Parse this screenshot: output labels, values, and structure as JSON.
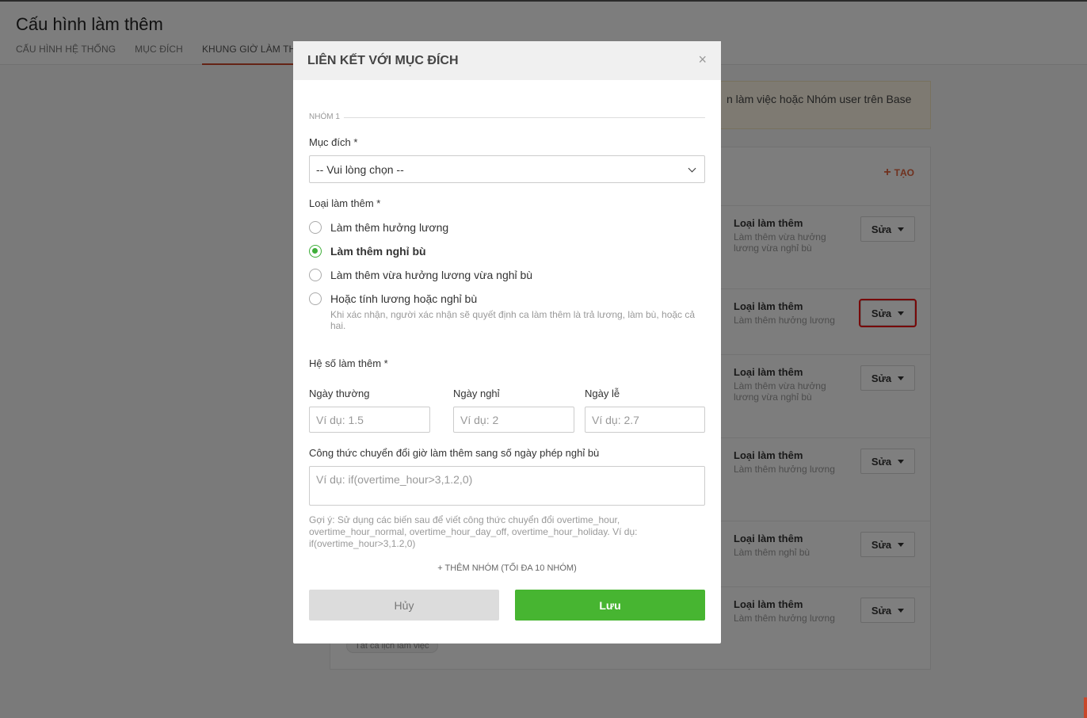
{
  "page": {
    "title": "Cấu hình làm thêm",
    "tabs": [
      "CẤU HÌNH HỆ THỐNG",
      "MỤC ĐÍCH",
      "KHUNG GIỜ LÀM THÊM"
    ],
    "notice": "n làm việc hoặc Nhóm user trên Base",
    "create_label": "TẠO",
    "chip": "Tất cả lịch làm việc",
    "rows": [
      {
        "title": "Loại làm thêm",
        "desc": "Làm thêm vừa hưởng lương vừa nghỉ bù",
        "edit": "Sửa"
      },
      {
        "title": "Loại làm thêm",
        "desc": "Làm thêm hưởng lương",
        "edit": "Sửa"
      },
      {
        "title": "Loại làm thêm",
        "desc": "Làm thêm vừa hưởng lương vừa nghỉ bù",
        "edit": "Sửa"
      },
      {
        "title": "Loại làm thêm",
        "desc": "Làm thêm hưởng lương",
        "edit": "Sửa"
      },
      {
        "title": "Loại làm thêm",
        "desc": "Làm thêm nghỉ bù",
        "edit": "Sửa"
      },
      {
        "title": "Loại làm thêm",
        "desc": "Làm thêm hưởng lương",
        "edit": "Sửa"
      }
    ]
  },
  "modal": {
    "title": "LIÊN KẾT VỚI MỤC ĐÍCH",
    "close": "×",
    "group_label": "NHÓM 1",
    "purpose_label": "Mục đích *",
    "purpose_value": "-- Vui lòng chọn --",
    "type_label": "Loại làm thêm *",
    "options": [
      {
        "label": "Làm thêm hưởng lương",
        "checked": false
      },
      {
        "label": "Làm thêm nghỉ bù",
        "checked": true
      },
      {
        "label": "Làm thêm vừa hưởng lương vừa nghỉ bù",
        "checked": false
      },
      {
        "label": "Hoặc tính lương hoặc nghỉ bù",
        "checked": false
      }
    ],
    "option_hint": "Khi xác nhận, người xác nhận sẽ quyết định ca làm thêm là trả lương, làm bù, hoặc cả hai.",
    "coef_label": "Hệ số làm thêm *",
    "coef_fields": [
      {
        "label": "Ngày thường",
        "placeholder": "Ví dụ: 1.5"
      },
      {
        "label": "Ngày nghỉ",
        "placeholder": "Ví dụ: 2"
      },
      {
        "label": "Ngày lễ",
        "placeholder": "Ví dụ: 2.7"
      }
    ],
    "formula_label": "Công thức chuyển đổi giờ làm thêm sang số ngày phép nghỉ bù",
    "formula_placeholder": "Ví dụ: if(overtime_hour>3,1.2,0)",
    "formula_hint": "Gợi ý: Sử dụng các biến sau để viết công thức chuyển đổi overtime_hour, overtime_hour_normal, overtime_hour_day_off, overtime_hour_holiday. Ví dụ: if(overtime_hour>3,1.2,0)",
    "add_group": "+ THÊM NHÓM (TỐI ĐA 10 NHÓM)",
    "cancel": "Hủy",
    "save": "Lưu"
  },
  "colors": {
    "accent": "#47b531",
    "brand": "#c9472a",
    "highlight": "#e11111"
  }
}
